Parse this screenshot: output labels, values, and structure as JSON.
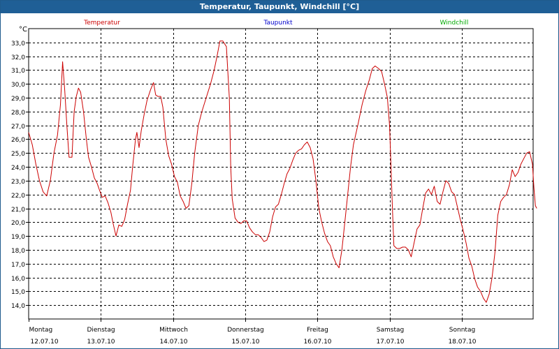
{
  "title": "Temperatur, Taupunkt, Windchill [°C]",
  "colors": {
    "temperatur": "#cc0000",
    "taupunkt": "#0000cc",
    "windchill": "#00aa00",
    "titlebar": "#1f5f96",
    "grid": "#000000"
  },
  "chart_data": {
    "type": "line",
    "ylabel": "°C",
    "ylim": [
      13.0,
      34.0
    ],
    "yticks": [
      "14,0",
      "15,0",
      "16,0",
      "17,0",
      "18,0",
      "19,0",
      "20,0",
      "21,0",
      "22,0",
      "23,0",
      "24,0",
      "25,0",
      "26,0",
      "27,0",
      "28,0",
      "29,0",
      "30,0",
      "31,0",
      "32,0",
      "33,0"
    ],
    "ytick_values": [
      14,
      15,
      16,
      17,
      18,
      19,
      20,
      21,
      22,
      23,
      24,
      25,
      26,
      27,
      28,
      29,
      30,
      31,
      32,
      33
    ],
    "xlim": [
      0,
      7
    ],
    "grid": true,
    "legend_placement": "top",
    "days": [
      {
        "name": "Montag",
        "date": "12.07.10",
        "x": 0
      },
      {
        "name": "Dienstag",
        "date": "13.07.10",
        "x": 1
      },
      {
        "name": "Mittwoch",
        "date": "14.07.10",
        "x": 2
      },
      {
        "name": "Donnerstag",
        "date": "15.07.10",
        "x": 3
      },
      {
        "name": "Freitag",
        "date": "16.07.10",
        "x": 4
      },
      {
        "name": "Samstag",
        "date": "17.07.10",
        "x": 5
      },
      {
        "name": "Sonntag",
        "date": "18.07.10",
        "x": 6
      }
    ],
    "series": [
      {
        "name": "Temperatur",
        "color": "#cc0000",
        "points": [
          [
            0.0,
            26.5
          ],
          [
            0.05,
            25.6
          ],
          [
            0.1,
            24.2
          ],
          [
            0.15,
            23.0
          ],
          [
            0.2,
            22.2
          ],
          [
            0.25,
            21.9
          ],
          [
            0.3,
            23.0
          ],
          [
            0.35,
            25.0
          ],
          [
            0.4,
            26.3
          ],
          [
            0.44,
            28.5
          ],
          [
            0.47,
            31.6
          ],
          [
            0.5,
            29.5
          ],
          [
            0.53,
            27.0
          ],
          [
            0.56,
            24.7
          ],
          [
            0.6,
            24.7
          ],
          [
            0.63,
            28.0
          ],
          [
            0.66,
            29.1
          ],
          [
            0.69,
            29.7
          ],
          [
            0.72,
            29.4
          ],
          [
            0.76,
            28.0
          ],
          [
            0.8,
            26.0
          ],
          [
            0.83,
            24.7
          ],
          [
            0.87,
            24.0
          ],
          [
            0.91,
            23.2
          ],
          [
            0.95,
            22.8
          ],
          [
            0.99,
            22.2
          ],
          [
            1.02,
            21.8
          ],
          [
            1.06,
            21.9
          ],
          [
            1.1,
            21.4
          ],
          [
            1.14,
            20.7
          ],
          [
            1.17,
            19.9
          ],
          [
            1.21,
            19.0
          ],
          [
            1.25,
            19.8
          ],
          [
            1.29,
            19.7
          ],
          [
            1.33,
            20.2
          ],
          [
            1.37,
            21.3
          ],
          [
            1.41,
            22.3
          ],
          [
            1.44,
            24.0
          ],
          [
            1.48,
            26.0
          ],
          [
            1.5,
            26.5
          ],
          [
            1.53,
            25.4
          ],
          [
            1.56,
            26.6
          ],
          [
            1.6,
            27.8
          ],
          [
            1.64,
            28.8
          ],
          [
            1.69,
            29.6
          ],
          [
            1.73,
            30.1
          ],
          [
            1.76,
            29.2
          ],
          [
            1.79,
            29.1
          ],
          [
            1.83,
            29.1
          ],
          [
            1.86,
            28.3
          ],
          [
            1.9,
            26.0
          ],
          [
            1.94,
            24.8
          ],
          [
            1.98,
            24.2
          ],
          [
            2.02,
            23.3
          ],
          [
            2.06,
            22.9
          ],
          [
            2.1,
            21.9
          ],
          [
            2.14,
            21.5
          ],
          [
            2.18,
            21.0
          ],
          [
            2.22,
            21.2
          ],
          [
            2.26,
            22.8
          ],
          [
            2.3,
            25.0
          ],
          [
            2.35,
            27.0
          ],
          [
            2.4,
            28.0
          ],
          [
            2.46,
            29.0
          ],
          [
            2.52,
            30.0
          ],
          [
            2.57,
            31.0
          ],
          [
            2.61,
            32.0
          ],
          [
            2.65,
            33.1
          ],
          [
            2.69,
            33.1
          ],
          [
            2.74,
            32.7
          ],
          [
            2.78,
            29.0
          ],
          [
            2.8,
            24.0
          ],
          [
            2.82,
            21.7
          ],
          [
            2.86,
            20.3
          ],
          [
            2.9,
            20.0
          ],
          [
            2.94,
            19.9
          ],
          [
            2.98,
            20.1
          ],
          [
            3.02,
            20.1
          ],
          [
            3.06,
            19.6
          ],
          [
            3.1,
            19.3
          ],
          [
            3.14,
            19.1
          ],
          [
            3.18,
            19.1
          ],
          [
            3.22,
            18.9
          ],
          [
            3.26,
            18.6
          ],
          [
            3.3,
            18.7
          ],
          [
            3.34,
            19.3
          ],
          [
            3.38,
            20.4
          ],
          [
            3.42,
            21.1
          ],
          [
            3.46,
            21.3
          ],
          [
            3.5,
            22.0
          ],
          [
            3.54,
            22.8
          ],
          [
            3.58,
            23.5
          ],
          [
            3.62,
            23.9
          ],
          [
            3.66,
            24.5
          ],
          [
            3.7,
            25.0
          ],
          [
            3.74,
            25.2
          ],
          [
            3.78,
            25.3
          ],
          [
            3.82,
            25.6
          ],
          [
            3.86,
            25.8
          ],
          [
            3.9,
            25.4
          ],
          [
            3.94,
            24.6
          ],
          [
            3.98,
            23.0
          ],
          [
            4.02,
            21.0
          ],
          [
            4.06,
            20.0
          ],
          [
            4.1,
            19.2
          ],
          [
            4.14,
            18.6
          ],
          [
            4.18,
            18.3
          ],
          [
            4.22,
            17.5
          ],
          [
            4.26,
            17.0
          ],
          [
            4.3,
            16.7
          ],
          [
            4.34,
            18.0
          ],
          [
            4.38,
            20.0
          ],
          [
            4.42,
            22.0
          ],
          [
            4.46,
            24.0
          ],
          [
            4.5,
            25.6
          ],
          [
            4.56,
            27.0
          ],
          [
            4.62,
            28.5
          ],
          [
            4.67,
            29.5
          ],
          [
            4.72,
            30.3
          ],
          [
            4.76,
            31.1
          ],
          [
            4.8,
            31.3
          ],
          [
            4.85,
            31.1
          ],
          [
            4.89,
            30.9
          ],
          [
            4.93,
            30.0
          ],
          [
            4.97,
            29.0
          ],
          [
            5.0,
            27.0
          ],
          [
            5.02,
            24.0
          ],
          [
            5.04,
            21.0
          ],
          [
            5.06,
            18.3
          ],
          [
            5.1,
            18.1
          ],
          [
            5.14,
            18.1
          ],
          [
            5.18,
            18.2
          ],
          [
            5.22,
            18.2
          ],
          [
            5.26,
            18.0
          ],
          [
            5.3,
            17.5
          ],
          [
            5.34,
            18.5
          ],
          [
            5.38,
            19.5
          ],
          [
            5.42,
            19.8
          ],
          [
            5.46,
            21.0
          ],
          [
            5.5,
            22.1
          ],
          [
            5.54,
            22.4
          ],
          [
            5.58,
            22.0
          ],
          [
            5.62,
            22.6
          ],
          [
            5.66,
            21.5
          ],
          [
            5.7,
            21.3
          ],
          [
            5.74,
            22.2
          ],
          [
            5.78,
            23.0
          ],
          [
            5.82,
            22.8
          ],
          [
            5.86,
            22.2
          ],
          [
            5.9,
            22.0
          ],
          [
            5.94,
            21.1
          ],
          [
            5.98,
            20.2
          ],
          [
            6.02,
            19.4
          ],
          [
            6.06,
            18.5
          ],
          [
            6.1,
            17.4
          ],
          [
            6.14,
            16.8
          ],
          [
            6.18,
            15.9
          ],
          [
            6.22,
            15.3
          ],
          [
            6.26,
            15.0
          ],
          [
            6.3,
            14.5
          ],
          [
            6.34,
            14.2
          ],
          [
            6.38,
            14.8
          ],
          [
            6.42,
            16.0
          ],
          [
            6.46,
            17.8
          ],
          [
            6.5,
            20.5
          ],
          [
            6.54,
            21.5
          ],
          [
            6.58,
            21.8
          ],
          [
            6.62,
            22.0
          ],
          [
            6.66,
            22.7
          ],
          [
            6.7,
            23.8
          ],
          [
            6.74,
            23.3
          ],
          [
            6.78,
            23.6
          ],
          [
            6.82,
            24.2
          ],
          [
            6.86,
            24.6
          ],
          [
            6.9,
            25.0
          ],
          [
            6.94,
            25.1
          ],
          [
            6.98,
            24.2
          ],
          [
            7.0,
            22.5
          ],
          [
            7.02,
            21.2
          ],
          [
            7.04,
            21.0
          ]
        ]
      }
    ],
    "legend": [
      {
        "label": "Temperatur",
        "color": "#cc0000"
      },
      {
        "label": "Taupunkt",
        "color": "#0000cc"
      },
      {
        "label": "Windchill",
        "color": "#00aa00"
      }
    ]
  }
}
